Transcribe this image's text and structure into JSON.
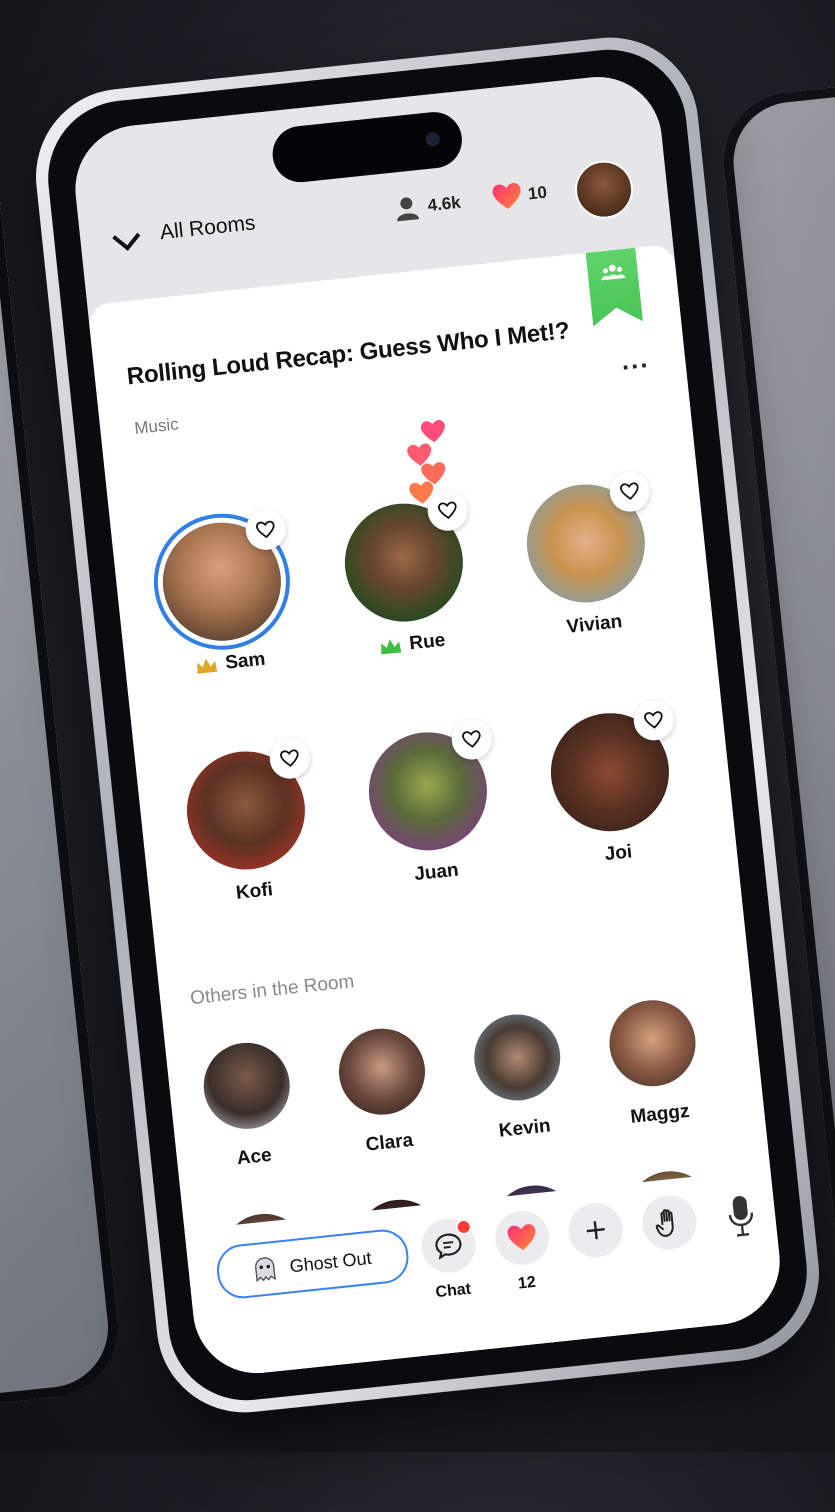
{
  "header": {
    "back_label": "All Rooms",
    "listeners_count": "4.6k",
    "likes_count": "10"
  },
  "room": {
    "title": "Rolling Loud Recap: Guess Who I Met!?",
    "category": "Music",
    "more_label": "..."
  },
  "speakers": [
    {
      "name": "Sam",
      "role": "host",
      "crown_color": "#e0a82a",
      "active": true,
      "avatar_color": "#a7744f"
    },
    {
      "name": "Rue",
      "role": "cohost",
      "crown_color": "#3fbf3f",
      "active": false,
      "avatar_color": "#3b5e2a"
    },
    {
      "name": "Vivian",
      "role": "speaker",
      "active": false,
      "avatar_color": "#c9934f"
    },
    {
      "name": "Kofi",
      "role": "speaker",
      "active": false,
      "avatar_color": "#7a3f2a"
    },
    {
      "name": "Juan",
      "role": "speaker",
      "active": false,
      "avatar_color": "#5a6b3a"
    },
    {
      "name": "Joi",
      "role": "speaker",
      "active": false,
      "avatar_color": "#5a3222"
    }
  ],
  "others_section_label": "Others in the Room",
  "others": [
    {
      "name": "Ace",
      "avatar_color": "#3a2e2a"
    },
    {
      "name": "Clara",
      "avatar_color": "#6b4a3e"
    },
    {
      "name": "Kevin",
      "avatar_color": "#4a3b33"
    },
    {
      "name": "Maggz",
      "avatar_color": "#8a5a44"
    }
  ],
  "bottom_bar": {
    "ghost_label": "Ghost Out",
    "chat_label": "Chat",
    "hearts_count": "12"
  },
  "colors": {
    "accent_blue": "#2f7fe6",
    "heart_gradient": [
      "#ff3b8a",
      "#ff7a2f"
    ],
    "bookmark_green": "#4cc85a",
    "notification_red": "#ff3b30"
  },
  "icons": [
    "chevron-down-icon",
    "person-icon",
    "heart-icon",
    "group-icon",
    "more-icon",
    "ghost-icon",
    "chat-icon",
    "plus-icon",
    "raise-hand-icon",
    "mic-icon",
    "crown-icon"
  ]
}
